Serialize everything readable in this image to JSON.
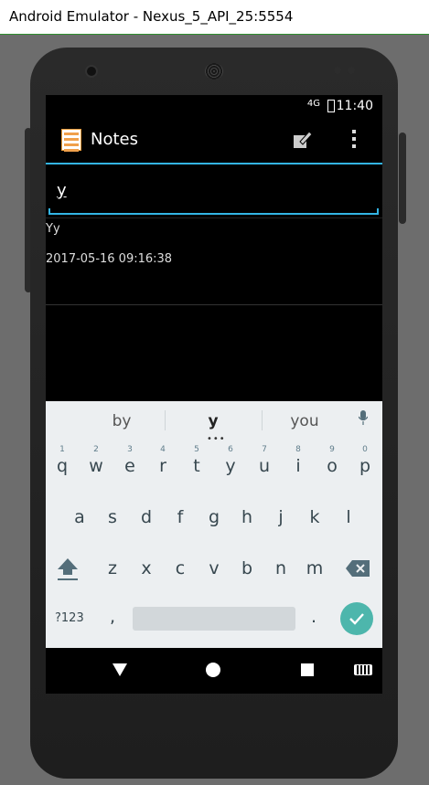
{
  "window": {
    "title": "Android Emulator - Nexus_5_API_25:5554"
  },
  "status_bar": {
    "network": "4G",
    "time": "11:40"
  },
  "action_bar": {
    "title": "Notes",
    "icons": [
      "notes-app-icon",
      "new-note-icon",
      "overflow-menu-icon"
    ]
  },
  "search": {
    "value": "y"
  },
  "notes": [
    {
      "title": "Yy",
      "date": "2017-05-16 09:16:38"
    }
  ],
  "keyboard": {
    "suggestions": [
      "by",
      "y",
      "you"
    ],
    "row1": [
      {
        "k": "q",
        "n": "1"
      },
      {
        "k": "w",
        "n": "2"
      },
      {
        "k": "e",
        "n": "3"
      },
      {
        "k": "r",
        "n": "4"
      },
      {
        "k": "t",
        "n": "5"
      },
      {
        "k": "y",
        "n": "6"
      },
      {
        "k": "u",
        "n": "7"
      },
      {
        "k": "i",
        "n": "8"
      },
      {
        "k": "o",
        "n": "9"
      },
      {
        "k": "p",
        "n": "0"
      }
    ],
    "row2": [
      "a",
      "s",
      "d",
      "f",
      "g",
      "h",
      "j",
      "k",
      "l"
    ],
    "row3": [
      "z",
      "x",
      "c",
      "v",
      "b",
      "n",
      "m"
    ],
    "symbols": "?123",
    "comma": ",",
    "period": ".",
    "accent": "#4db6ac"
  },
  "nav_bar": {
    "icons": [
      "back-icon",
      "home-icon",
      "recents-icon",
      "keyboard-switch-icon"
    ]
  }
}
